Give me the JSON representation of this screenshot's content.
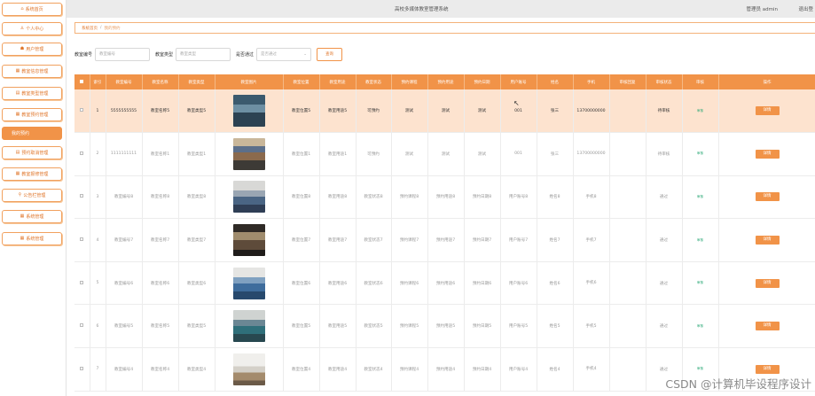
{
  "header": {
    "title": "高校多媒体教室管理系统",
    "user": "管理员 admin",
    "logout": "退出登"
  },
  "sidebar": {
    "items": [
      {
        "label": "系统首页",
        "icon": "home-icon",
        "glyph": "⌂"
      },
      {
        "label": "个人中心",
        "icon": "user-icon",
        "glyph": "♙"
      },
      {
        "label": "用户管理",
        "icon": "users-icon",
        "glyph": "☗"
      },
      {
        "label": "教室信息管理",
        "icon": "grid-icon",
        "glyph": "▦"
      },
      {
        "label": "教室类型管理",
        "icon": "building-icon",
        "glyph": "▤"
      },
      {
        "label": "教室预约管理",
        "icon": "grid-icon",
        "glyph": "▦"
      },
      {
        "label": "我的预约",
        "icon": "calendar-icon",
        "glyph": ""
      },
      {
        "label": "预约取消管理",
        "icon": "list-icon",
        "glyph": "▤"
      },
      {
        "label": "教室报修管理",
        "icon": "grid-icon",
        "glyph": "▦"
      },
      {
        "label": "公告栏管理",
        "icon": "pin-icon",
        "glyph": "⚲"
      },
      {
        "label": "系统管理",
        "icon": "grid-icon",
        "glyph": "▦"
      },
      {
        "label": "系统管理",
        "icon": "grid-icon",
        "glyph": "▦"
      }
    ],
    "active_index": 6
  },
  "breadcrumb": {
    "home": "系统首页",
    "separator": "/",
    "current": "我的预约"
  },
  "search": {
    "room_no_label": "教室编号",
    "room_no_placeholder": "教室编号",
    "room_type_label": "教室类型",
    "room_type_placeholder": "教室类型",
    "approved_label": "是否通过",
    "approved_placeholder": "是否通过",
    "query_button": "查询"
  },
  "table": {
    "columns": [
      "",
      "索引",
      "教室编号",
      "教室名称",
      "教室类型",
      "教室图片",
      "教室位置",
      "教室用途",
      "教室状态",
      "预约课程",
      "预约用途",
      "预约日期",
      "用户账号",
      "姓名",
      "手机",
      "审核回复",
      "审核状态",
      "审核",
      "操作"
    ],
    "rows": [
      {
        "index": "1",
        "room_no": "5555555555",
        "room_name": "教室名称5",
        "room_type": "教室类型5",
        "location": "教室位置5",
        "purpose": "教室用途5",
        "room_status": "可预约",
        "course": "测试",
        "usage": "测试",
        "date": "测试",
        "account": "001",
        "name": "张三",
        "phone": "13700000000",
        "reply": "",
        "audit_status": "待审核",
        "audit": "审核",
        "action": "详情",
        "highlight": true
      },
      {
        "index": "2",
        "room_no": "1111111111",
        "room_name": "教室名称1",
        "room_type": "教室类型1",
        "location": "教室位置1",
        "purpose": "教室用途1",
        "room_status": "可预约",
        "course": "测试",
        "usage": "测试",
        "date": "测试",
        "account": "001",
        "name": "张三",
        "phone": "13700000000",
        "reply": "",
        "audit_status": "待审核",
        "audit": "审核",
        "action": "详情",
        "highlight": false
      },
      {
        "index": "3",
        "room_no": "教室编号8",
        "room_name": "教室名称8",
        "room_type": "教室类型8",
        "location": "教室位置8",
        "purpose": "教室用途8",
        "room_status": "教室状态8",
        "course": "预约课程8",
        "usage": "预约用途8",
        "date": "预约日期8",
        "account": "用户账号8",
        "name": "姓名8",
        "phone": "手机8",
        "reply": "",
        "audit_status": "通过",
        "audit": "审核",
        "action": "详情",
        "highlight": false
      },
      {
        "index": "4",
        "room_no": "教室编号7",
        "room_name": "教室名称7",
        "room_type": "教室类型7",
        "location": "教室位置7",
        "purpose": "教室用途7",
        "room_status": "教室状态7",
        "course": "预约课程7",
        "usage": "预约用途7",
        "date": "预约日期7",
        "account": "用户账号7",
        "name": "姓名7",
        "phone": "手机7",
        "reply": "",
        "audit_status": "通过",
        "audit": "审核",
        "action": "详情",
        "highlight": false
      },
      {
        "index": "5",
        "room_no": "教室编号6",
        "room_name": "教室名称6",
        "room_type": "教室类型6",
        "location": "教室位置6",
        "purpose": "教室用途6",
        "room_status": "教室状态6",
        "course": "预约课程6",
        "usage": "预约用途6",
        "date": "预约日期6",
        "account": "用户账号6",
        "name": "姓名6",
        "phone": "手机6",
        "reply": "",
        "audit_status": "通过",
        "audit": "审核",
        "action": "详情",
        "highlight": false
      },
      {
        "index": "6",
        "room_no": "教室编号5",
        "room_name": "教室名称5",
        "room_type": "教室类型5",
        "location": "教室位置5",
        "purpose": "教室用途5",
        "room_status": "教室状态5",
        "course": "预约课程5",
        "usage": "预约用途5",
        "date": "预约日期5",
        "account": "用户账号5",
        "name": "姓名5",
        "phone": "手机5",
        "reply": "",
        "audit_status": "通过",
        "audit": "审核",
        "action": "详情",
        "highlight": false
      },
      {
        "index": "7",
        "room_no": "教室编号4",
        "room_name": "教室名称4",
        "room_type": "教室类型4",
        "location": "教室位置4",
        "purpose": "教室用途4",
        "room_status": "教室状态4",
        "course": "预约课程4",
        "usage": "预约用途4",
        "date": "预约日期4",
        "account": "用户账号4",
        "name": "姓名4",
        "phone": "手机4",
        "reply": "",
        "audit_status": "通过",
        "audit": "审核",
        "action": "详情",
        "highlight": false
      }
    ]
  },
  "watermark": "CSDN @计算机毕设程序设计",
  "colors": {
    "accent": "#f19348",
    "accent_text": "#e0772c",
    "highlight_row": "#fde3cf",
    "audit_link": "#2aa876"
  }
}
